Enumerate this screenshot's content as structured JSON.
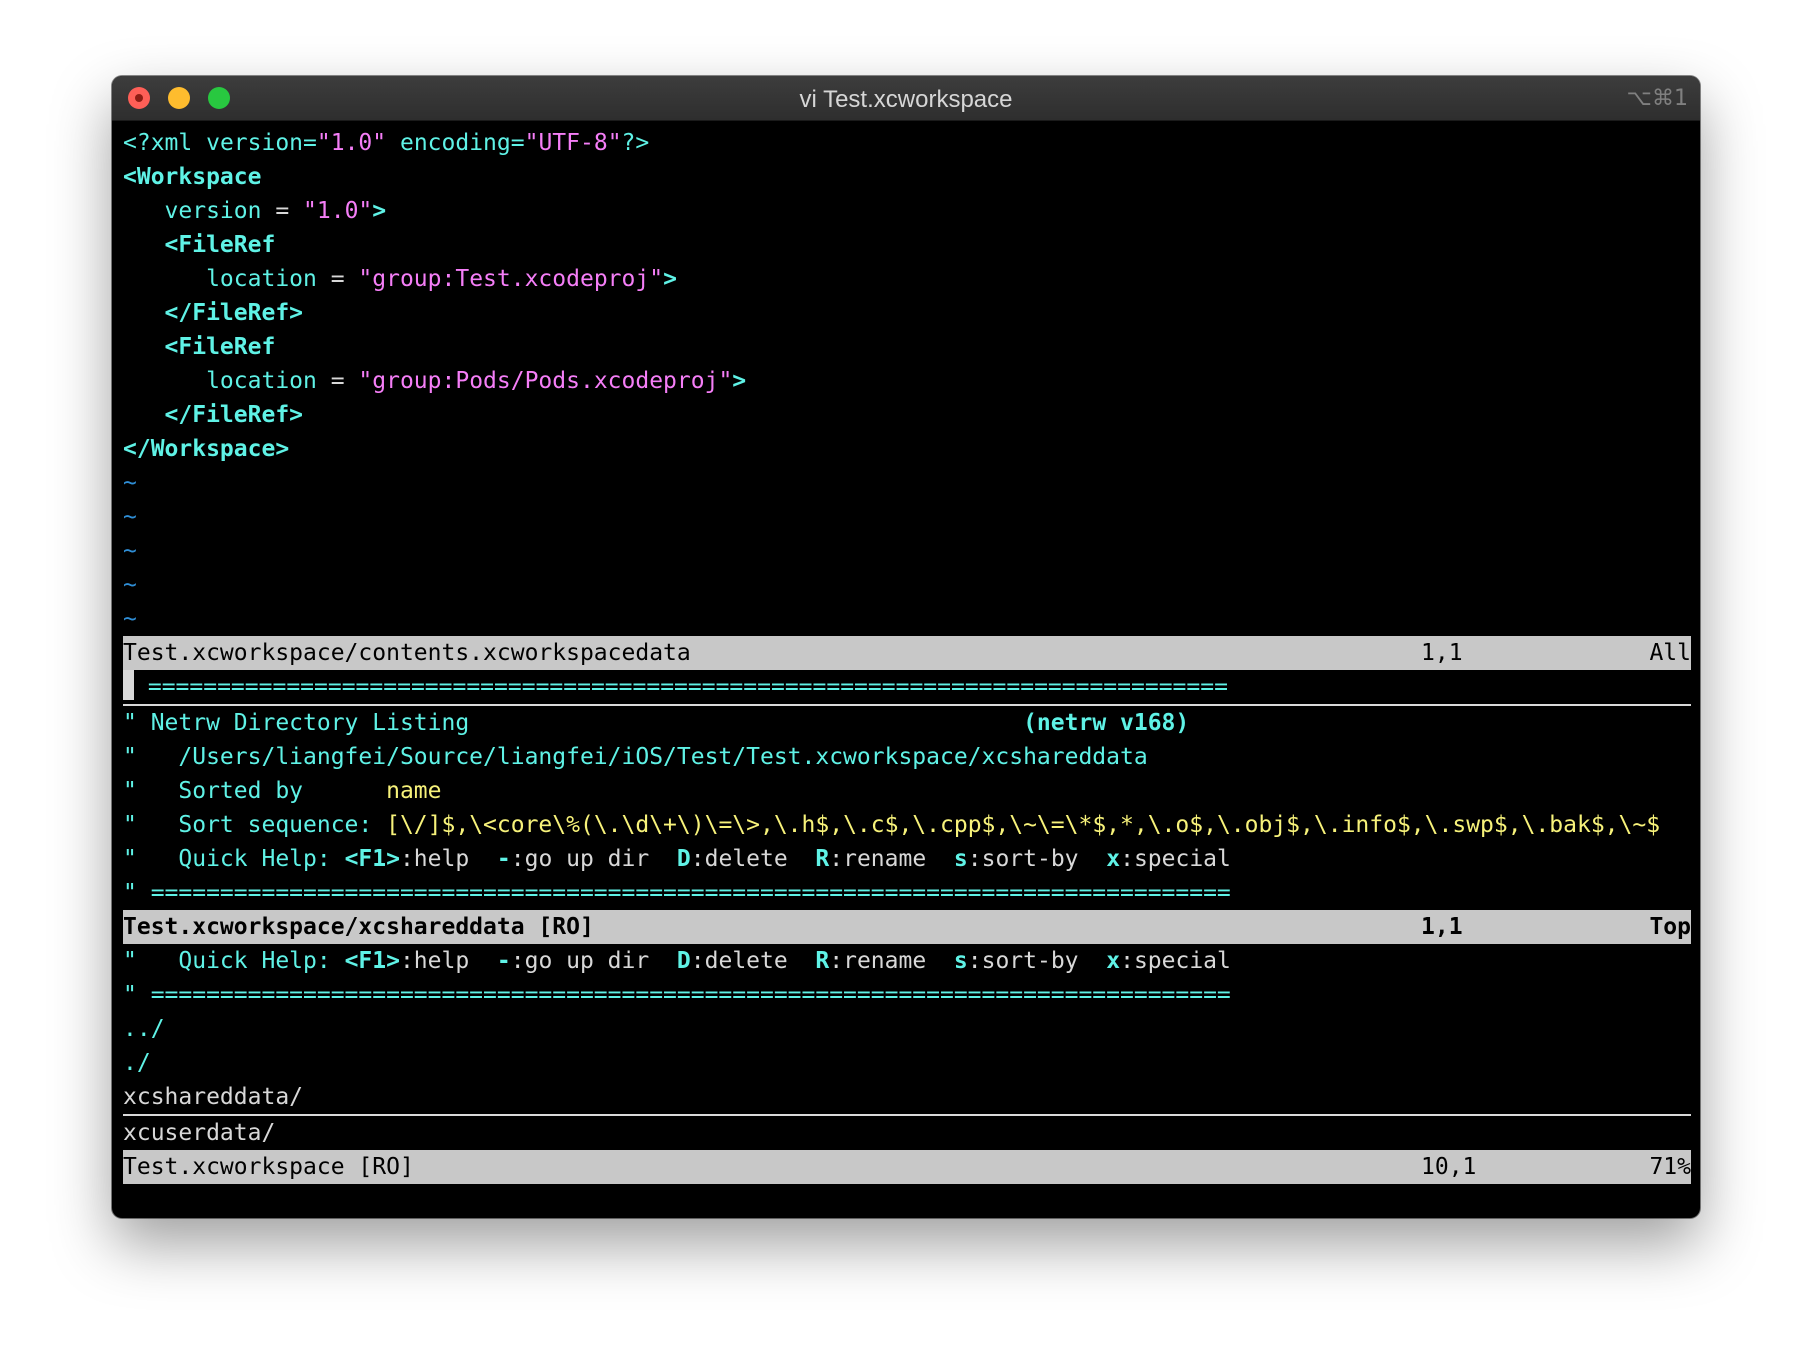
{
  "window": {
    "title": "vi Test.xcworkspace",
    "shortcut": "⌥⌘1"
  },
  "top_buffer": {
    "lines": [
      {
        "parts": [
          {
            "c": "tag",
            "t": "<?xml "
          },
          {
            "c": "attr",
            "t": "version="
          },
          {
            "c": "str",
            "t": "\"1.0\""
          },
          {
            "c": "attr",
            "t": " encoding="
          },
          {
            "c": "str",
            "t": "\"UTF-8\""
          },
          {
            "c": "tag",
            "t": "?>"
          }
        ]
      },
      {
        "parts": [
          {
            "c": "tagb",
            "t": "<Workspace"
          }
        ]
      },
      {
        "parts": [
          {
            "c": "attr",
            "t": "   version "
          },
          {
            "c": "wt",
            "t": "= "
          },
          {
            "c": "str",
            "t": "\"1.0\""
          },
          {
            "c": "tagb",
            "t": ">"
          }
        ]
      },
      {
        "parts": [
          {
            "c": "tagb",
            "t": "   <FileRef"
          }
        ]
      },
      {
        "parts": [
          {
            "c": "attr",
            "t": "      location "
          },
          {
            "c": "wt",
            "t": "= "
          },
          {
            "c": "str",
            "t": "\"group:Test.xcodeproj\""
          },
          {
            "c": "tagb",
            "t": ">"
          }
        ]
      },
      {
        "parts": [
          {
            "c": "tagb",
            "t": "   </FileRef>"
          }
        ]
      },
      {
        "parts": [
          {
            "c": "tagb",
            "t": "   <FileRef"
          }
        ]
      },
      {
        "parts": [
          {
            "c": "attr",
            "t": "      location "
          },
          {
            "c": "wt",
            "t": "= "
          },
          {
            "c": "str",
            "t": "\"group:Pods/Pods.xcodeproj\""
          },
          {
            "c": "tagb",
            "t": ">"
          }
        ]
      },
      {
        "parts": [
          {
            "c": "tagb",
            "t": "   </FileRef>"
          }
        ]
      },
      {
        "parts": [
          {
            "c": "tagb",
            "t": "</Workspace>"
          }
        ]
      },
      {
        "parts": [
          {
            "c": "tilde",
            "t": "~"
          }
        ]
      },
      {
        "parts": [
          {
            "c": "tilde",
            "t": "~"
          }
        ]
      },
      {
        "parts": [
          {
            "c": "tilde",
            "t": "~"
          }
        ]
      },
      {
        "parts": [
          {
            "c": "tilde",
            "t": "~"
          }
        ]
      },
      {
        "parts": [
          {
            "c": "tilde",
            "t": "~"
          }
        ]
      }
    ],
    "status": {
      "file": "Test.xcworkspace/contents.xcworkspacedata",
      "pos": "1,1",
      "pct": "All"
    }
  },
  "middle_buffer": {
    "rule_first": " ==============================================================================",
    "lines": [
      {
        "parts": [
          {
            "c": "cy",
            "t": "\" Netrw Directory Listing                                        "
          },
          {
            "c": "cyb",
            "t": "(netrw v168)"
          }
        ]
      },
      {
        "parts": [
          {
            "c": "cy",
            "t": "\"   /Users/liangfei/Source/liangfei/iOS/Test/Test.xcworkspace/xcshareddata"
          }
        ]
      },
      {
        "parts": [
          {
            "c": "cy",
            "t": "\"   Sorted by      "
          },
          {
            "c": "yel",
            "t": "name"
          }
        ]
      },
      {
        "parts": [
          {
            "c": "cy",
            "t": "\"   Sort sequence: "
          },
          {
            "c": "yel",
            "t": "[\\/]$,\\<core\\%(\\.\\d\\+\\)\\=\\>,\\.h$,\\.c$,\\.cpp$,\\~\\=\\*$,*,\\.o$,\\.obj$,\\.info$,\\.swp$,\\.bak$,\\~$"
          }
        ]
      },
      {
        "parts": [
          {
            "c": "cy",
            "t": "\"   Quick Help: "
          },
          {
            "c": "cyb",
            "t": "<F1>"
          },
          {
            "c": "wt",
            "t": ":help  "
          },
          {
            "c": "cyb",
            "t": "-"
          },
          {
            "c": "wt",
            "t": ":go up dir  "
          },
          {
            "c": "cyb",
            "t": "D"
          },
          {
            "c": "wt",
            "t": ":delete  "
          },
          {
            "c": "cyb",
            "t": "R"
          },
          {
            "c": "wt",
            "t": ":rename  "
          },
          {
            "c": "cyb",
            "t": "s"
          },
          {
            "c": "wt",
            "t": ":sort-by  "
          },
          {
            "c": "cyb",
            "t": "x"
          },
          {
            "c": "wt",
            "t": ":special"
          }
        ]
      },
      {
        "parts": [
          {
            "c": "cy",
            "t": "\" =============================================================================="
          }
        ]
      }
    ],
    "status": {
      "file": "Test.xcworkspace/xcshareddata [RO]",
      "pos": "1,1",
      "pct": "Top"
    }
  },
  "bottom_buffer": {
    "lines": [
      {
        "parts": [
          {
            "c": "cy",
            "t": "\"   Quick Help: "
          },
          {
            "c": "cyb",
            "t": "<F1>"
          },
          {
            "c": "wt",
            "t": ":help  "
          },
          {
            "c": "cyb",
            "t": "-"
          },
          {
            "c": "wt",
            "t": ":go up dir  "
          },
          {
            "c": "cyb",
            "t": "D"
          },
          {
            "c": "wt",
            "t": ":delete  "
          },
          {
            "c": "cyb",
            "t": "R"
          },
          {
            "c": "wt",
            "t": ":rename  "
          },
          {
            "c": "cyb",
            "t": "s"
          },
          {
            "c": "wt",
            "t": ":sort-by  "
          },
          {
            "c": "cyb",
            "t": "x"
          },
          {
            "c": "wt",
            "t": ":special"
          }
        ]
      },
      {
        "parts": [
          {
            "c": "cy",
            "t": "\" =============================================================================="
          }
        ]
      },
      {
        "parts": [
          {
            "c": "cy",
            "t": "../"
          }
        ]
      },
      {
        "parts": [
          {
            "c": "cy",
            "t": "./"
          }
        ]
      },
      {
        "parts": [
          {
            "c": "wt",
            "t": "xcshareddata/"
          }
        ],
        "underline": true
      },
      {
        "parts": [
          {
            "c": "wt",
            "t": "xcuserdata/"
          }
        ]
      }
    ],
    "status": {
      "file": "Test.xcworkspace [RO]",
      "pos": "10,1",
      "pct": "71%"
    }
  }
}
